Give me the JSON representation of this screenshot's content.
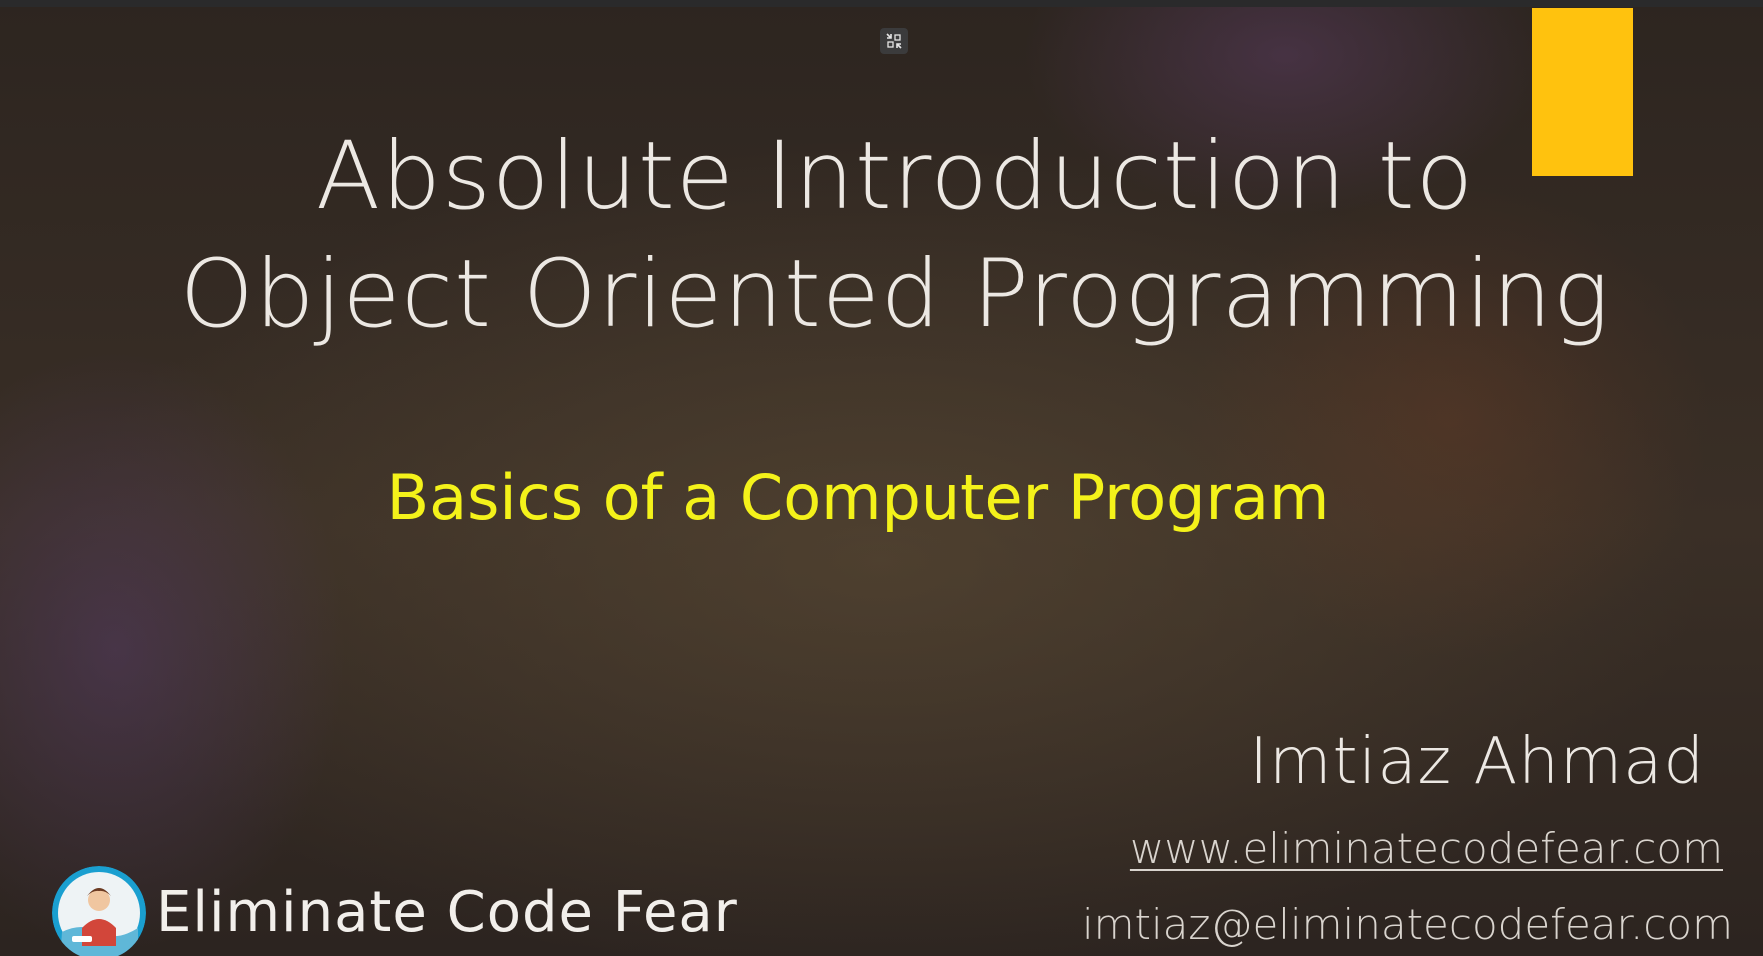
{
  "slide": {
    "title_line1": "Absolute Introduction to",
    "title_line2": "Object Oriented Programming",
    "subtitle": "Basics of a Computer Program",
    "author": "Imtiaz Ahmad",
    "website": "www.eliminatecodefear.com",
    "email": "imtiaz@eliminatecodefear.com",
    "brand_name": "Eliminate Code Fear"
  },
  "controls": {
    "exit_fullscreen_icon": "exit-fullscreen-icon"
  },
  "colors": {
    "accent_block": "#ffc20e",
    "subtitle_text": "#f4f21a",
    "title_text": "#ece8e3",
    "logo_ring": "#1a9fd0"
  }
}
